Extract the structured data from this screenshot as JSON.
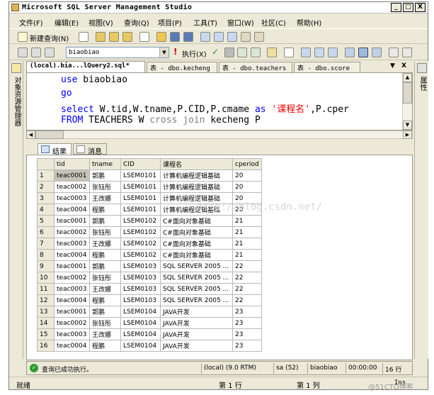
{
  "window": {
    "title": "Microsoft SQL Server Management Studio",
    "controls": {
      "minimize": "_",
      "maximize": "□",
      "close": "X"
    }
  },
  "menu": [
    "文件(F)",
    "编辑(E)",
    "视图(V)",
    "查询(Q)",
    "项目(P)",
    "工具(T)",
    "窗口(W)",
    "社区(C)",
    "帮助(H)"
  ],
  "toolbar1": {
    "new_query": "新建查询(N)"
  },
  "toolbar2": {
    "database": "biaobiao",
    "execute": "执行(X)"
  },
  "left_panel": {
    "label": "对象资源管理器"
  },
  "right_panel": {
    "label": "属性"
  },
  "tabs": [
    {
      "label": "(local).bia...lQuery2.sql*",
      "active": true
    },
    {
      "label": "表 - dbo.kecheng",
      "active": false
    },
    {
      "label": "表 - dbo.teachers",
      "active": false
    },
    {
      "label": "表 - dbo.score",
      "active": false
    }
  ],
  "tab_controls": {
    "dropdown": "▼",
    "close": "X"
  },
  "editor": {
    "line1": {
      "kw": "use",
      "rest": " biaobiao"
    },
    "line2": {
      "kw": "go"
    },
    "line3": {
      "kw": "select",
      "mid": " W.tid,W.tname,P.CID,P.cmame ",
      "kw2": "as",
      "str": " '课程名'",
      "rest": ",P.cper"
    },
    "line4": {
      "kw": "FROM",
      "mid": " TEACHERS W ",
      "gray": "cross join",
      "rest": " kecheng P"
    }
  },
  "results": {
    "tab_results": "结果",
    "tab_messages": "消息",
    "columns": [
      "tid",
      "tname",
      "CID",
      "课程名",
      "cperiod"
    ],
    "rows": [
      [
        "1",
        "teac0001",
        "郭鹏",
        "LSEM0101",
        "计算机编程逻辑基础",
        "20"
      ],
      [
        "2",
        "teac0002",
        "张钰彤",
        "LSEM0101",
        "计算机编程逻辑基础",
        "20"
      ],
      [
        "3",
        "teac0003",
        "王改娜",
        "LSEM0101",
        "计算机编程逻辑基础",
        "20"
      ],
      [
        "4",
        "teac0004",
        "程鹏",
        "LSEM0101",
        "计算机编程逻辑基础",
        "20"
      ],
      [
        "5",
        "teac0001",
        "郭鹏",
        "LSEM0102",
        "C#面向对象基础",
        "21"
      ],
      [
        "6",
        "teac0002",
        "张钰彤",
        "LSEM0102",
        "C#面向对象基础",
        "21"
      ],
      [
        "7",
        "teac0003",
        "王改娜",
        "LSEM0102",
        "C#面向对象基础",
        "21"
      ],
      [
        "8",
        "teac0004",
        "程鹏",
        "LSEM0102",
        "C#面向对象基础",
        "21"
      ],
      [
        "9",
        "teac0001",
        "郭鹏",
        "LSEM0103",
        "SQL SERVER 2005 ...",
        "22"
      ],
      [
        "10",
        "teac0002",
        "张钰彤",
        "LSEM0103",
        "SQL SERVER 2005 ...",
        "22"
      ],
      [
        "11",
        "teac0003",
        "王改娜",
        "LSEM0103",
        "SQL SERVER 2005 ...",
        "22"
      ],
      [
        "12",
        "teac0004",
        "程鹏",
        "LSEM0103",
        "SQL SERVER 2005 ...",
        "22"
      ],
      [
        "13",
        "teac0001",
        "郭鹏",
        "LSEM0104",
        "JAVA开发",
        "23"
      ],
      [
        "14",
        "teac0002",
        "张钰彤",
        "LSEM0104",
        "JAVA开发",
        "23"
      ],
      [
        "15",
        "teac0003",
        "王改娜",
        "LSEM0104",
        "JAVA开发",
        "23"
      ],
      [
        "16",
        "teac0004",
        "程鹏",
        "LSEM0104",
        "JAVA开发",
        "23"
      ]
    ],
    "watermark": "http://blog.csdn.net/"
  },
  "query_status": {
    "message": "查询已成功执行。",
    "server": "(local) (9.0 RTM)",
    "user": "sa (52)",
    "database": "biaobiao",
    "time": "00:00:00",
    "rows": "16 行"
  },
  "statusbar": {
    "ready": "就绪",
    "line": "第 1 行",
    "col": "第 1 列",
    "ins": "Ins",
    "brand": "@51CTO博客"
  }
}
